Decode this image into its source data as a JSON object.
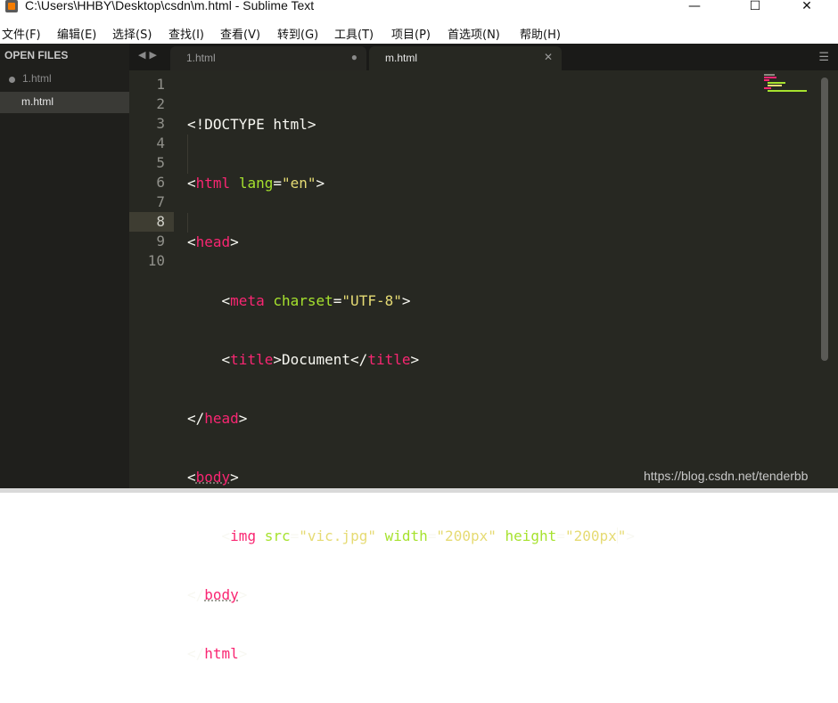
{
  "window": {
    "title": "C:\\Users\\HHBY\\Desktop\\csdn\\m.html - Sublime Text",
    "minimize_icon": "minimize-icon",
    "maximize_icon": "maximize-icon",
    "close_icon": "close-icon"
  },
  "menu": [
    "文件(F)",
    "编辑(E)",
    "选择(S)",
    "查找(I)",
    "查看(V)",
    "转到(G)",
    "工具(T)",
    "项目(P)",
    "首选项(N)",
    "帮助(H)"
  ],
  "sidebar": {
    "heading": "OPEN FILES",
    "files": [
      {
        "label": "1.html",
        "dirty": true
      },
      {
        "label": "m.html",
        "dirty": false
      }
    ]
  },
  "tabs": [
    {
      "label": "1.html",
      "button": "●"
    },
    {
      "label": "m.html",
      "button": "✕"
    }
  ],
  "editor": {
    "current_line": 8,
    "line_numbers": [
      "1",
      "2",
      "3",
      "4",
      "5",
      "6",
      "7",
      "8",
      "9",
      "10"
    ]
  },
  "code": {
    "l1": [
      "<!DOCTYPE html>"
    ],
    "l2": [
      "<",
      "html",
      " ",
      "lang",
      "=",
      "\"en\"",
      ">"
    ],
    "l3": [
      "<",
      "head",
      ">"
    ],
    "l4": [
      "    <",
      "meta",
      " ",
      "charset",
      "=",
      "\"UTF-8\"",
      ">"
    ],
    "l5": [
      "    <",
      "title",
      ">",
      "Document",
      "</",
      "title",
      ">"
    ],
    "l6": [
      "</",
      "head",
      ">"
    ],
    "l7": [
      "<",
      "body",
      ">"
    ],
    "l8": [
      "    <",
      "img",
      " ",
      "src",
      "=",
      "\"vic.jpg\"",
      " ",
      "width",
      "=",
      "\"200px\"",
      " ",
      "height",
      "=",
      "\"200px",
      "\"",
      ">"
    ],
    "l9": [
      "</",
      "body",
      ">"
    ],
    "l10": [
      "</",
      "html",
      ">"
    ]
  },
  "watermark": "https://blog.csdn.net/tenderbb",
  "colors": {
    "editor_bg": "#272822",
    "tag": "#f92672",
    "attribute": "#a6e22e",
    "string": "#e6db74",
    "text": "#f8f8f2"
  }
}
